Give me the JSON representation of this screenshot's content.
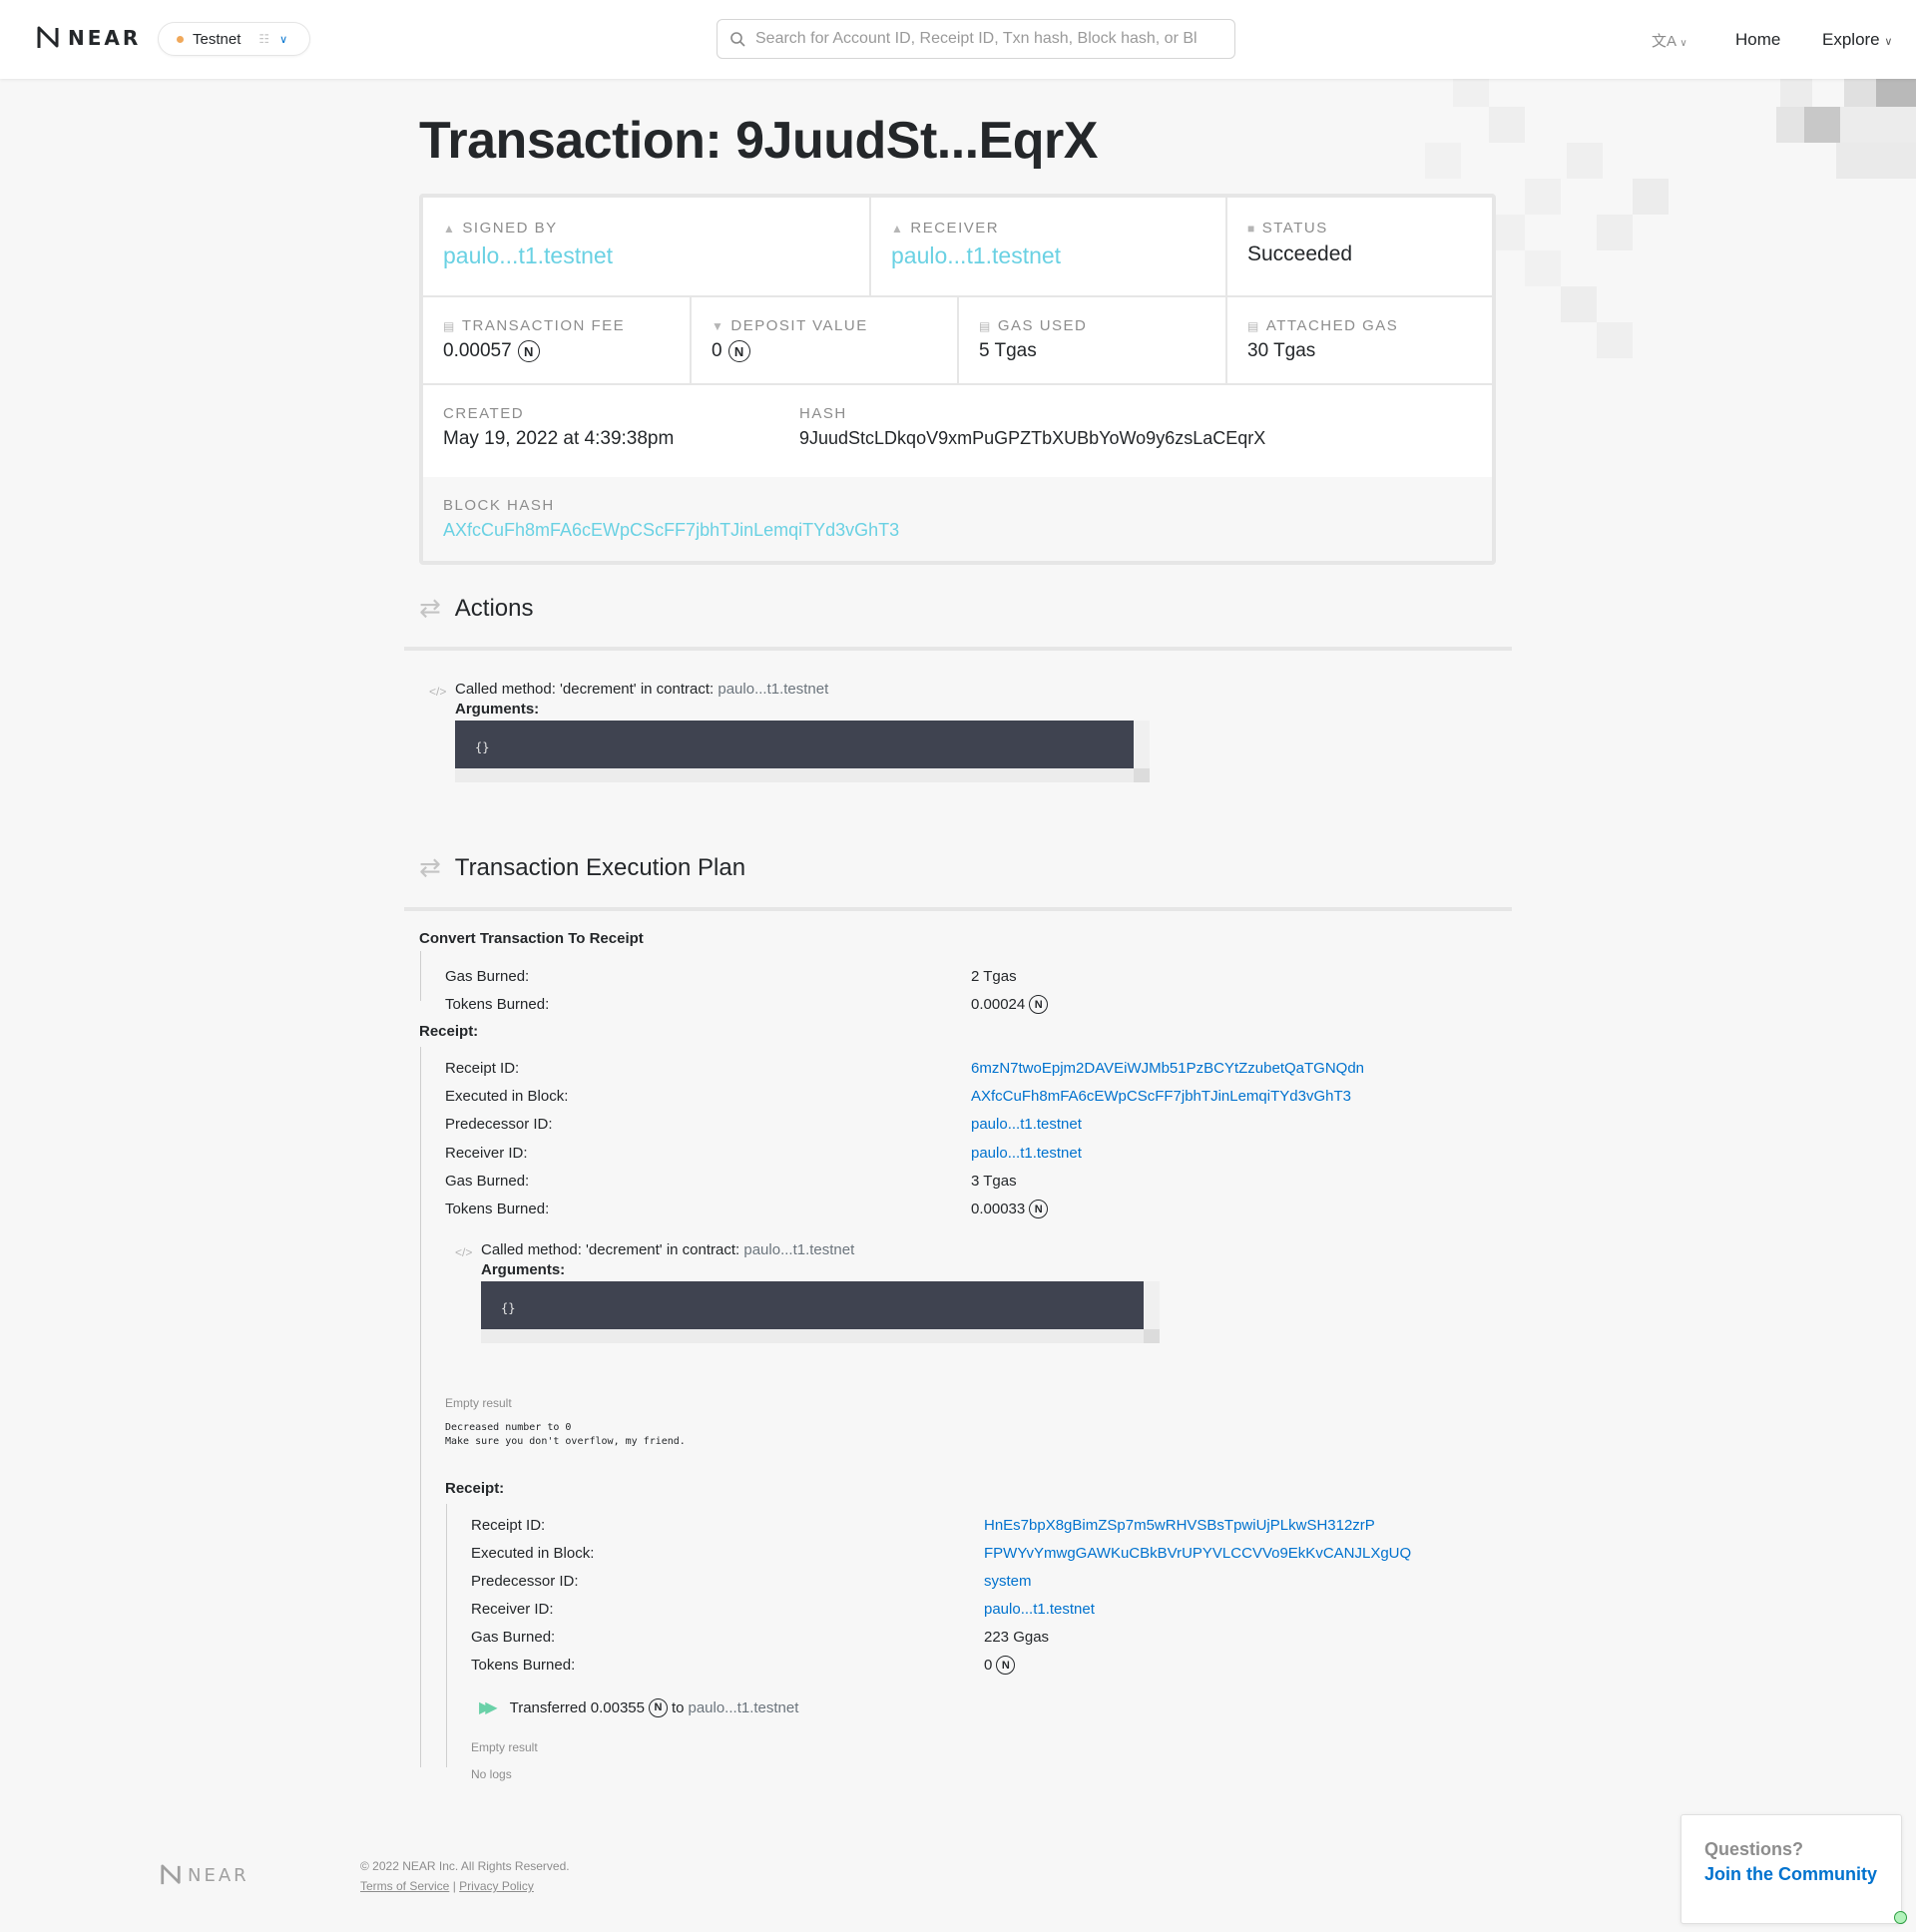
{
  "header": {
    "logo_text": "NEAR",
    "network": "Testnet",
    "search_placeholder": "Search for Account ID, Receipt ID, Txn hash, Block hash, or Bl",
    "nav_home": "Home",
    "nav_explore": "Explore"
  },
  "title": "Transaction: 9JuudSt...EqrX",
  "summary": {
    "signed_by_label": "SIGNED BY",
    "signed_by": "paulo...t1.testnet",
    "receiver_label": "RECEIVER",
    "receiver": "paulo...t1.testnet",
    "status_label": "STATUS",
    "status": "Succeeded",
    "fee_label": "TRANSACTION FEE",
    "fee": "0.00057",
    "deposit_label": "DEPOSIT VALUE",
    "deposit": "0",
    "gas_used_label": "GAS USED",
    "gas_used": "5 Tgas",
    "attached_gas_label": "ATTACHED GAS",
    "attached_gas": "30 Tgas",
    "created_label": "CREATED",
    "created": "May 19, 2022 at 4:39:38pm",
    "hash_label": "HASH",
    "hash": "9JuudStcLDkqoV9xmPuGPZTbXUBbYoWo9y6zsLaCEqrX",
    "block_hash_label": "BLOCK HASH",
    "block_hash": "AXfcCuFh8mFA6cEWpCScFF7jbhTJinLemqiTYd3vGhT3"
  },
  "actions": {
    "title": "Actions",
    "called_text": "Called method: 'decrement' in contract:",
    "contract": "paulo...t1.testnet",
    "arguments_label": "Arguments:",
    "arguments": "{}"
  },
  "plan": {
    "title": "Transaction Execution Plan",
    "convert_title": "Convert Transaction To Receipt",
    "convert_gas_label": "Gas Burned:",
    "convert_gas": "2 Tgas",
    "convert_tokens_label": "Tokens Burned:",
    "convert_tokens": "0.00024",
    "receipt_title": "Receipt:",
    "receipt1": {
      "receipt_id_label": "Receipt ID:",
      "receipt_id": "6mzN7twoEpjm2DAVEiWJMb51PzBCYtZzubetQaTGNQdn",
      "block_label": "Executed in Block:",
      "block": "AXfcCuFh8mFA6cEWpCScFF7jbhTJinLemqiTYd3vGhT3",
      "predecessor_label": "Predecessor ID:",
      "predecessor": "paulo...t1.testnet",
      "receiver_label": "Receiver ID:",
      "receiver": "paulo...t1.testnet",
      "gas_label": "Gas Burned:",
      "gas": "3 Tgas",
      "tokens_label": "Tokens Burned:",
      "tokens": "0.00033",
      "called_text": "Called method: 'decrement' in contract:",
      "contract": "paulo...t1.testnet",
      "arguments_label": "Arguments:",
      "arguments": "{}",
      "result": "Empty result",
      "logs": "Decreased number to 0\nMake sure you don't overflow, my friend."
    },
    "receipt2": {
      "title": "Receipt:",
      "receipt_id_label": "Receipt ID:",
      "receipt_id": "HnEs7bpX8gBimZSp7m5wRHVSBsTpwiUjPLkwSH312zrP",
      "block_label": "Executed in Block:",
      "block": "FPWYvYmwgGAWKuCBkBVrUPYVLCCVVo9EkKvCANJLXgUQ",
      "predecessor_label": "Predecessor ID:",
      "predecessor": "system",
      "receiver_label": "Receiver ID:",
      "receiver": "paulo...t1.testnet",
      "gas_label": "Gas Burned:",
      "gas": "223 Ggas",
      "tokens_label": "Tokens Burned:",
      "tokens": "0",
      "transfer_prefix": "Transferred 0.00355",
      "transfer_to": "to",
      "transfer_account": "paulo...t1.testnet",
      "result": "Empty result",
      "logs": "No logs"
    }
  },
  "footer": {
    "logo_text": "NEAR",
    "copyright": "© 2022 NEAR Inc. All Rights Reserved.",
    "terms": "Terms of Service",
    "privacy": "Privacy Policy",
    "questions": "Questions?",
    "join": "Join the Community"
  },
  "colors": {
    "link": "#0072ce",
    "accent_link": "#6ad1e3",
    "code_bg": "#3f4350",
    "network_dot": "#f0a85a"
  }
}
